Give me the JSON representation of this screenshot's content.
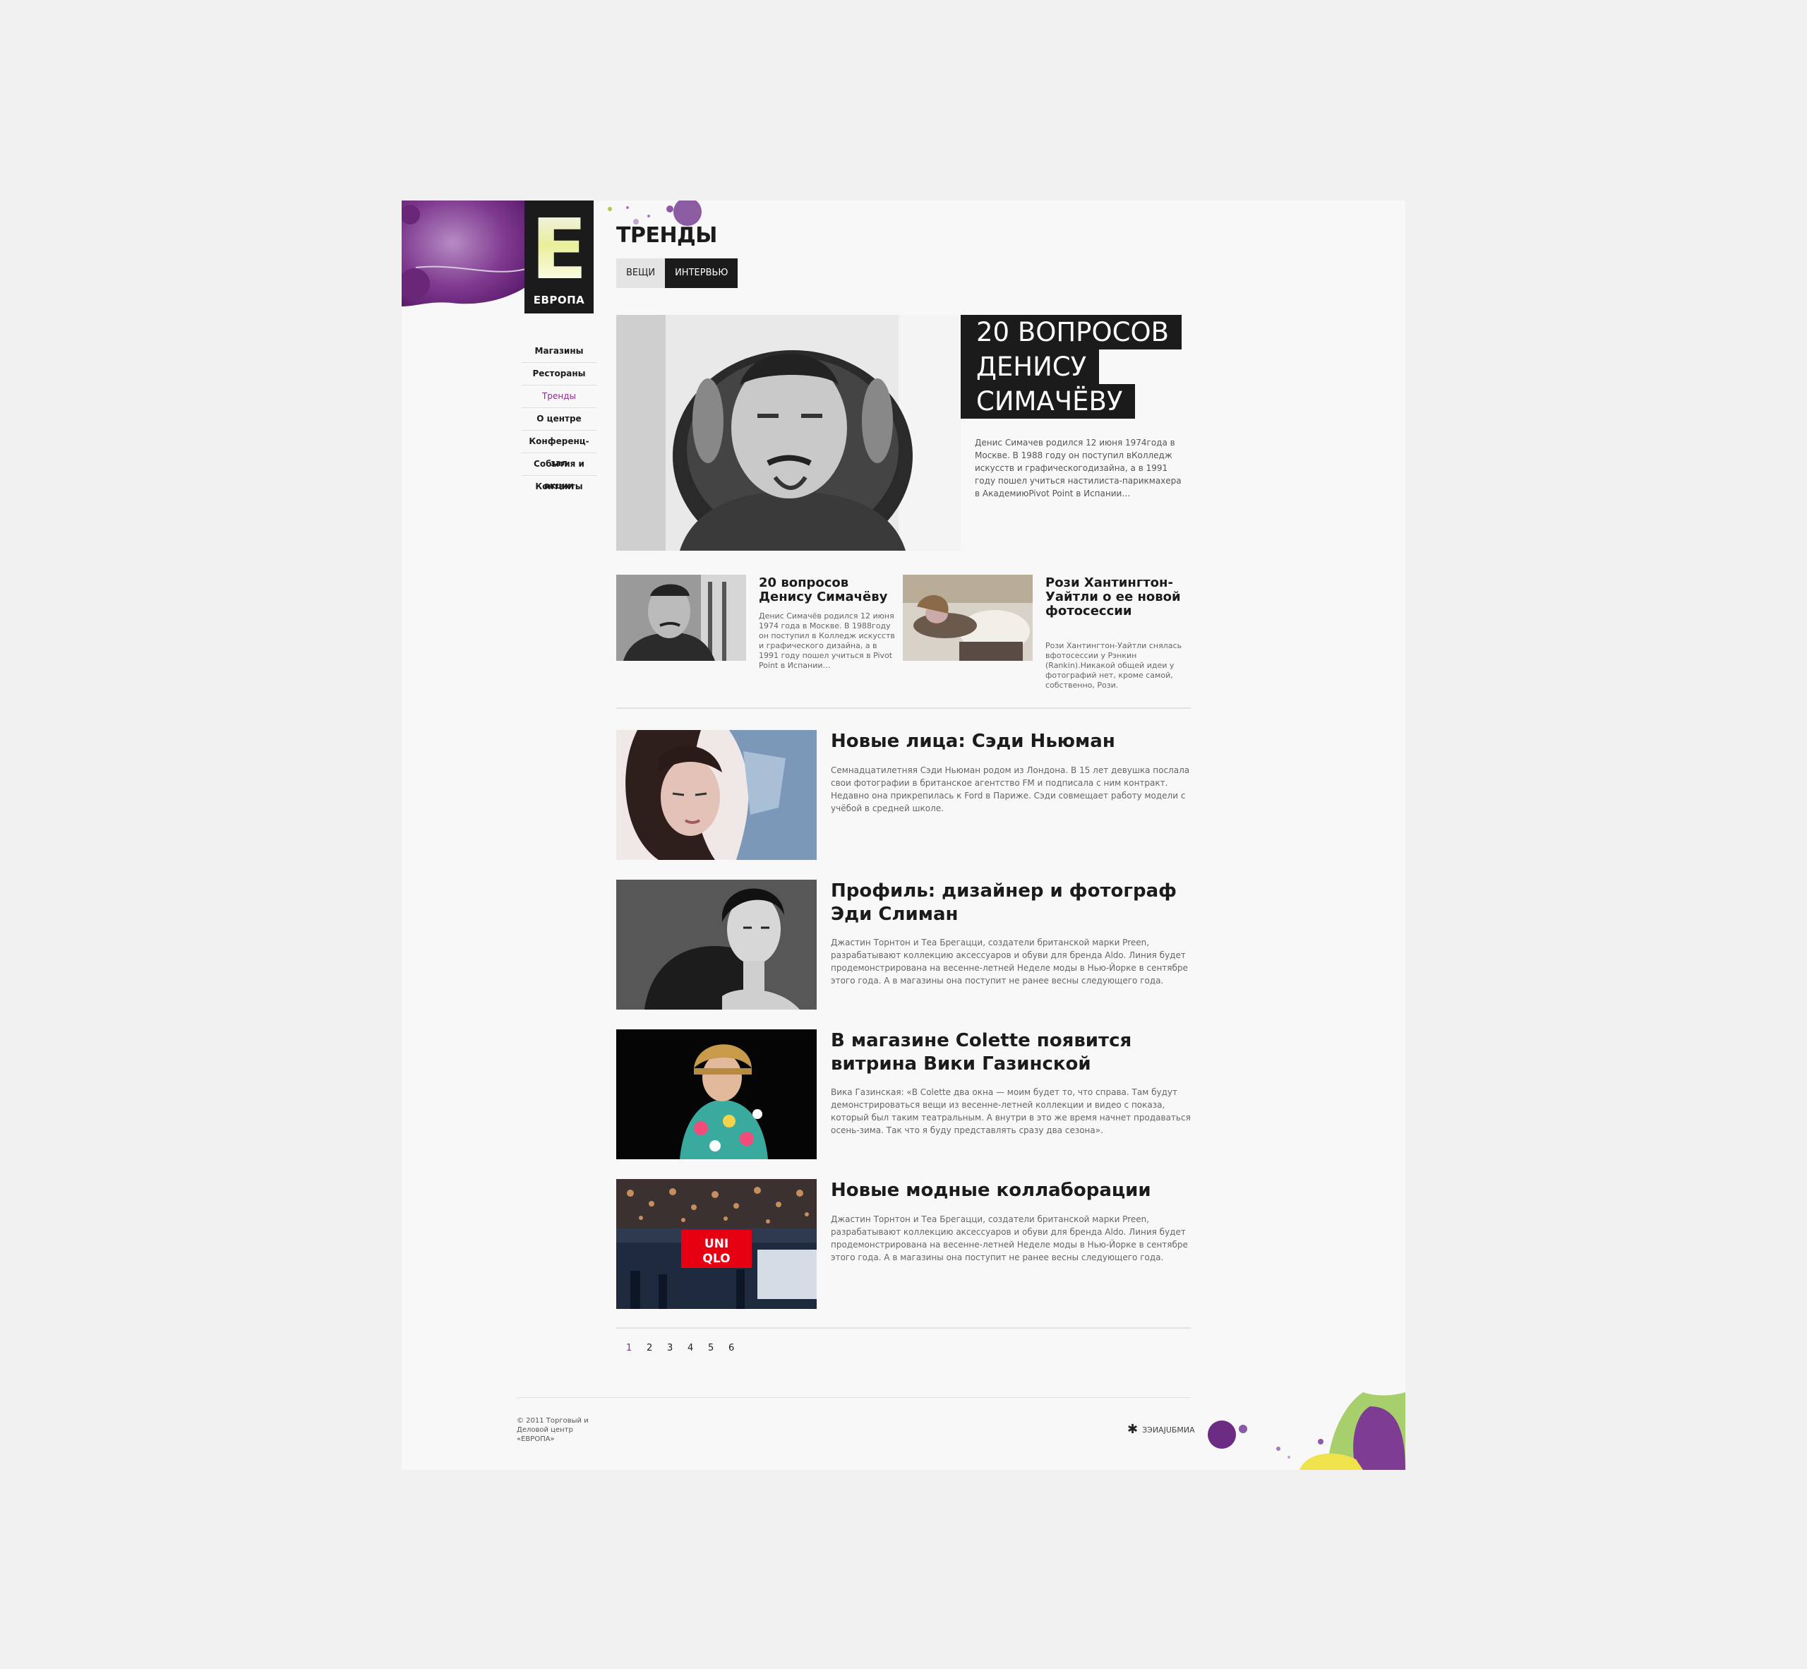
{
  "brand": {
    "logo_letter": "E",
    "logo_word": "ЕВРОПА"
  },
  "nav": {
    "items": [
      {
        "label": "Магазины"
      },
      {
        "label": "Рестораны"
      },
      {
        "label": "Тренды",
        "active": true
      },
      {
        "label": "О центре"
      },
      {
        "label": "Конференц-зал"
      },
      {
        "label": "События и акции"
      },
      {
        "label": "Контакты"
      }
    ]
  },
  "page": {
    "title": "ТРЕНДЫ",
    "tabs": [
      {
        "label": "ВЕЩИ",
        "active": false
      },
      {
        "label": "ИНТЕРВЬЮ",
        "active": true
      }
    ]
  },
  "hero": {
    "title_lines": [
      "20 ВОПРОСОВ",
      "ДЕНИСУ",
      "СИМАЧЁВУ"
    ],
    "text": "Денис Симачев родился 12 июня 1974года в Москве. В 1988 году он поступил вКолледж искусств и графическогодизайна, а в 1991 году пошел учиться настилиста-парикмахера в АкадемиюPivot Point в Испании…"
  },
  "cards": [
    {
      "title": "20 вопросов Денису Симачёву",
      "text": "Денис Симачёв родился 12 июня 1974 года в Москве. В 1988году он поступил в Колледж искусств и графического дизайна, а в 1991 году пошел учиться в Pivot Point в Испании…"
    },
    {
      "title": "Рози Хантингтон-Уайтли о ее новой фотосессии",
      "text": "Рози Хантингтон-Уайтли снялась вфотосессии у Рэнкин (Rankin).Никакой общей идеи у фотографий нет, кроме самой, собственно, Рози."
    }
  ],
  "articles": [
    {
      "title": "Новые лица: Сэди Ньюман",
      "text": "Семнадцатилетняя Сэди Ньюман родом из Лондона. В 15 лет девушка послала свои фотографии в британское агентство FM и подписала с ним контракт. Недавно она прикрепилась к Ford в Париже. Сэди совмещает работу модели с учёбой в средней школе."
    },
    {
      "title": "Профиль: дизайнер и фотограф Эди Слиман",
      "text": "Джастин Торнтон и Теа Брегацци, создатели британской марки Preen, разрабатывают коллекцию аксессуаров и обуви для бренда Aldo. Линия будет продемонстрирована на весенне-летней Неделе моды в Нью-Йорке в сентябре этого года. А в магазины она поступит не ранее весны следующего года."
    },
    {
      "title": "В магазине Colette появится витрина Вики Газинской",
      "text": "Вика Газинская: «В Colette два окна — моим будет то, что справа. Там будут демонстрироваться вещи из весенне-летней коллекции и видео с показа, который был таким театральным. А внутри в это же время начнет продаваться осень-зима. Так что я буду представлять сразу два сезона»."
    },
    {
      "title": "Новые модные коллаборации",
      "text": "Джастин Торнтон и Теа Брегацци, создатели британской марки Preen, разрабатывают коллекцию аксессуаров и обуви для бренда Aldo. Линия будет продемонстрирована на весенне-летней Неделе моды в Нью-Йорке в сентябре этого года. А в магазины она поступит не ранее весны следующего года.",
      "sign": {
        "top": "UNI",
        "bottom": "QLO"
      }
    }
  ],
  "pagination": {
    "pages": [
      "1",
      "2",
      "3",
      "4",
      "5",
      "6"
    ],
    "current": "1"
  },
  "footer": {
    "copyright": "© 2011 Торговый и Деловой центр «ЕВРОПА»",
    "developer": "ЗЭИАJUБМИА"
  },
  "colors": {
    "accent": "#8a2b8e",
    "dark": "#1b1b1b",
    "page_bg": "#f8f8f8"
  }
}
